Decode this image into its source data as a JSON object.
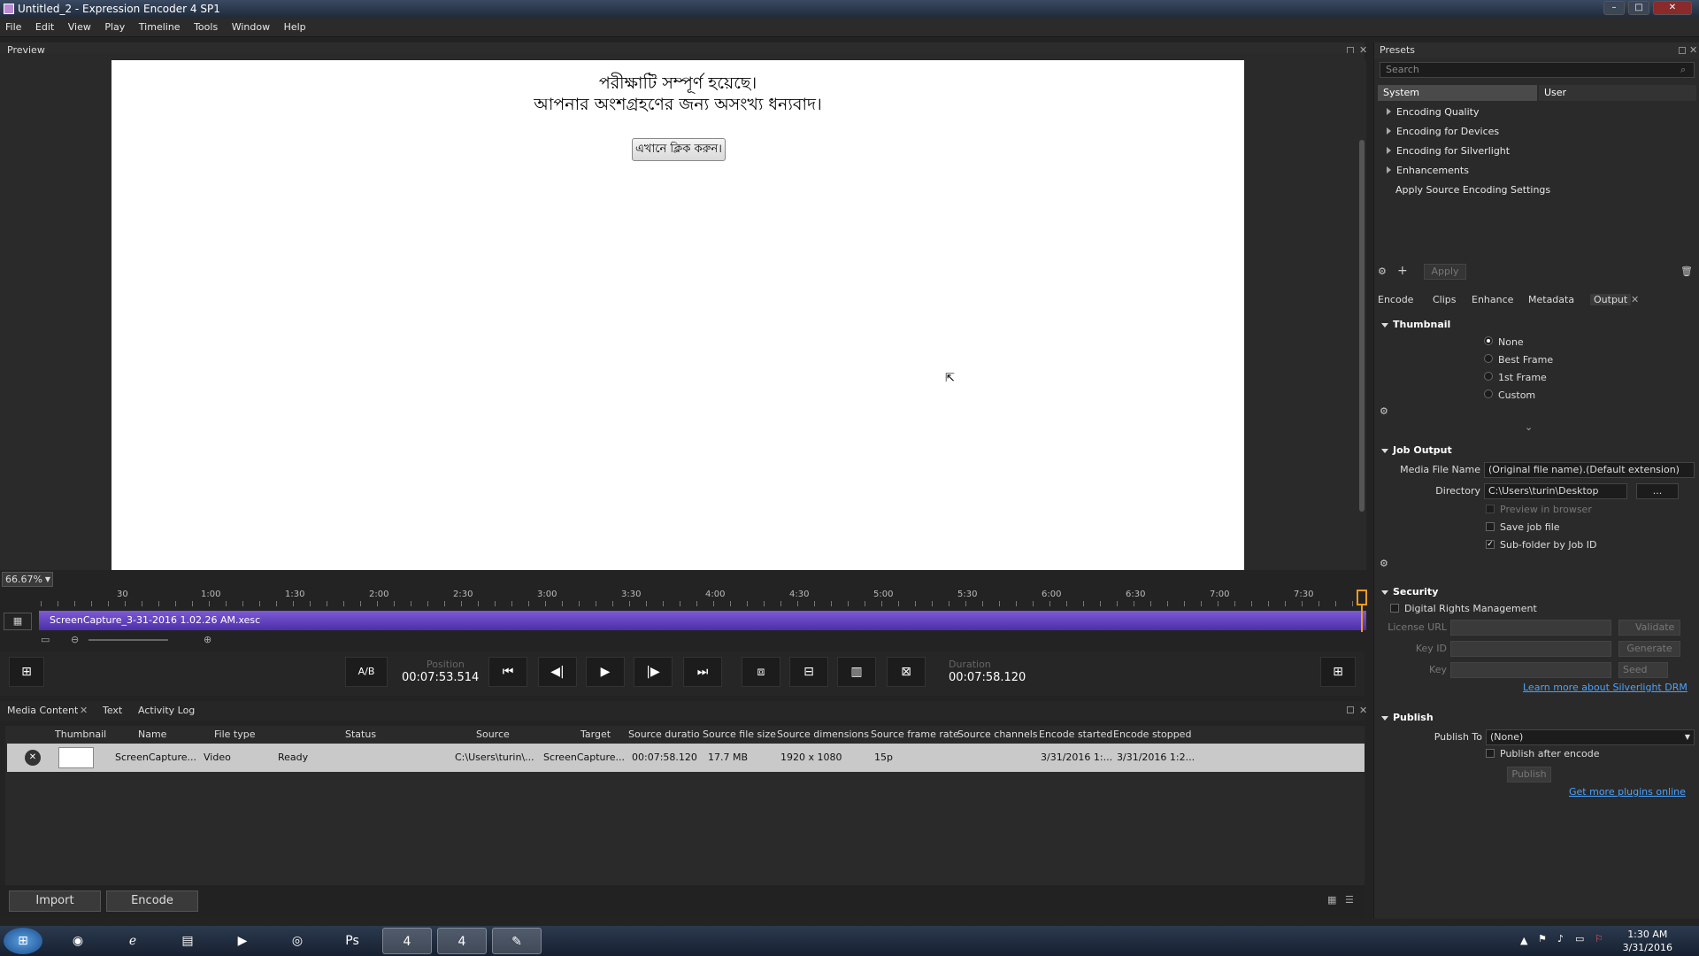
{
  "window": {
    "title": "Untitled_2 - Expression Encoder 4 SP1"
  },
  "menu": [
    "File",
    "Edit",
    "View",
    "Play",
    "Timeline",
    "Tools",
    "Window",
    "Help"
  ],
  "preview": {
    "title": "Preview",
    "line1": "পরীক্ষাটি সম্পূর্ণ হয়েছে।",
    "line2": "আপনার অংশগ্রহণের জন্য অসংখ্য ধন্যবাদ।",
    "button": "এখানে ক্লিক করুন।"
  },
  "timeline": {
    "zoom": "66.67%",
    "ticks": [
      "30",
      "1:00",
      "1:30",
      "2:00",
      "2:30",
      "3:00",
      "3:30",
      "4:00",
      "4:30",
      "5:00",
      "5:30",
      "6:00",
      "6:30",
      "7:00",
      "7:30"
    ],
    "clip_name": "ScreenCapture_3-31-2016 1.02.26 AM.xesc"
  },
  "transport": {
    "ab_label": "A/B",
    "position_caption": "Position",
    "position": "00:07:53.514",
    "duration_caption": "Duration",
    "duration": "00:07:58.120"
  },
  "media_tabs": [
    "Media Content",
    "Text",
    "Activity Log"
  ],
  "media_table": {
    "headers": [
      "Thumbnail",
      "Name",
      "File type",
      "Status",
      "Source",
      "Target",
      "Source duratio",
      "Source file size",
      "Source dimensions",
      "Source frame rate",
      "Source channels",
      "Encode started",
      "Encode stopped"
    ],
    "row": {
      "name": "ScreenCapture...",
      "file_type": "Video",
      "status": "Ready",
      "source": "C:\\Users\\turin\\...",
      "target": "ScreenCapture...",
      "duration": "00:07:58.120",
      "size": "17.7 MB",
      "dimensions": "1920 x 1080",
      "frame_rate": "15p",
      "started": "3/31/2016 1:...",
      "stopped": "3/31/2016 1:2..."
    }
  },
  "bottom": {
    "import": "Import",
    "encode": "Encode"
  },
  "presets": {
    "title": "Presets",
    "search_placeholder": "Search",
    "tabs": [
      "System",
      "User"
    ],
    "items": [
      "Encoding Quality",
      "Encoding for Devices",
      "Encoding for Silverlight",
      "Enhancements",
      "Apply Source Encoding Settings"
    ],
    "apply": "Apply"
  },
  "right_tabs": [
    "Encode",
    "Clips",
    "Enhance",
    "Metadata",
    "Output"
  ],
  "thumbnail": {
    "title": "Thumbnail",
    "options": [
      "None",
      "Best Frame",
      "1st Frame",
      "Custom"
    ],
    "selected": "None"
  },
  "job_output": {
    "title": "Job Output",
    "media_file_name_label": "Media File Name",
    "media_file_name": "(Original file name).(Default extension)",
    "directory_label": "Directory",
    "directory": "C:\\Users\\turin\\Desktop",
    "browse": "...",
    "preview_in_browser": "Preview in browser",
    "save_job_file": "Save job file",
    "sub_folder": "Sub-folder by Job ID"
  },
  "security": {
    "title": "Security",
    "drm": "Digital Rights Management",
    "license_url": "License URL",
    "validate": "Validate",
    "key_id": "Key ID",
    "generate": "Generate",
    "key": "Key",
    "seed": "Seed",
    "learn_more": "Learn more about Silverlight DRM"
  },
  "publish": {
    "title": "Publish",
    "publish_to_label": "Publish To",
    "publish_to": "(None)",
    "after_encode": "Publish after encode",
    "publish_btn": "Publish",
    "more_plugins": "Get more plugins online"
  },
  "taskbar": {
    "time": "1:30 AM",
    "date": "3/31/2016"
  }
}
